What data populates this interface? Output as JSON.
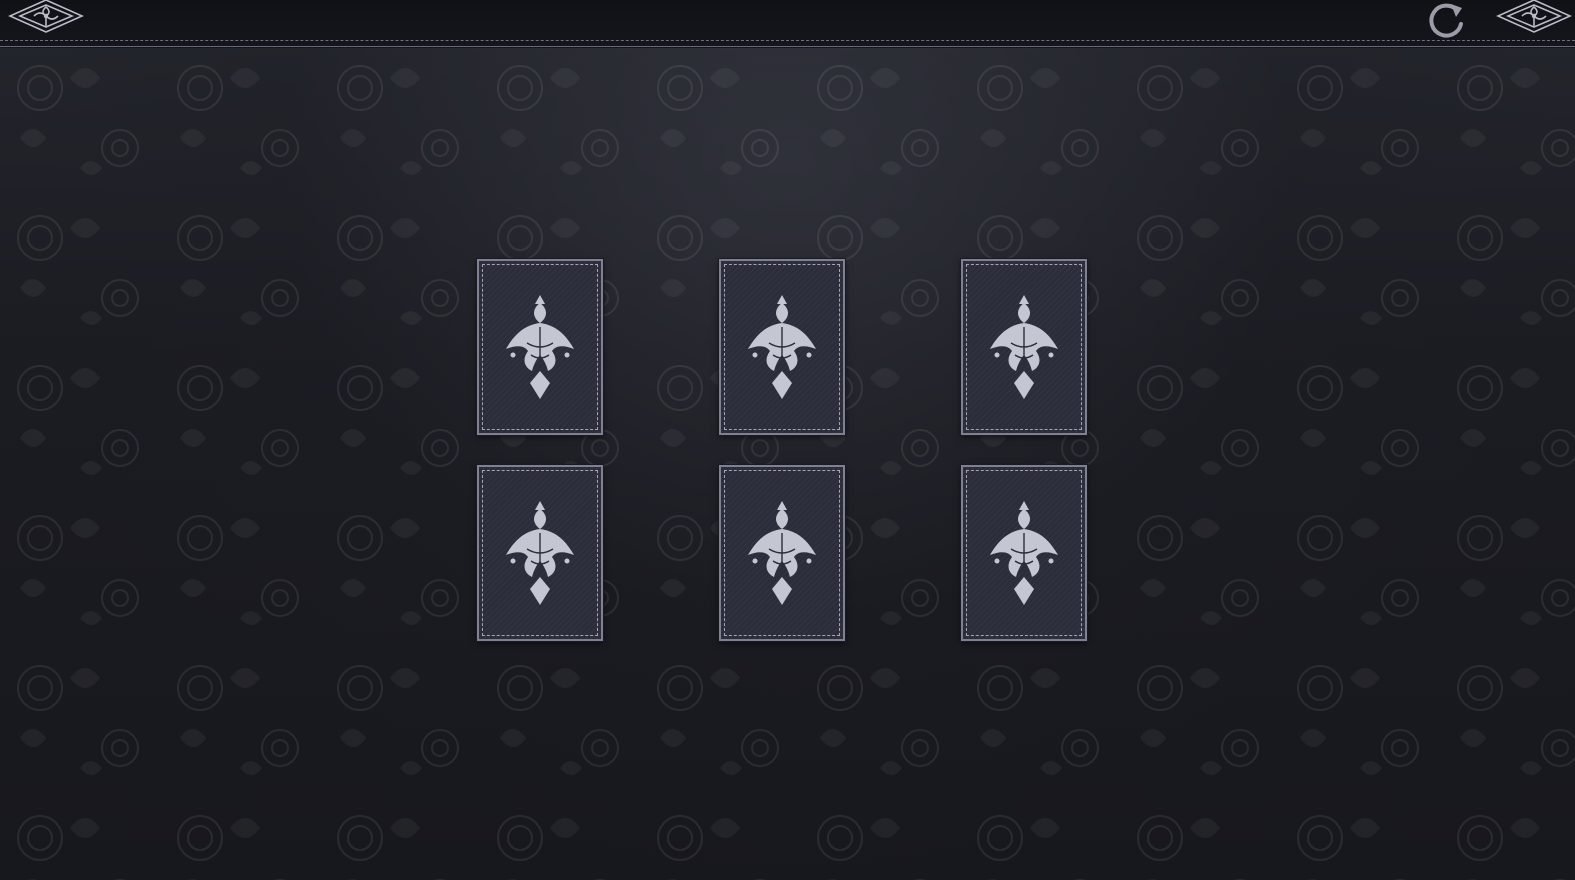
{
  "game": {
    "type": "memory-match",
    "face_down_cards": 6,
    "grid": {
      "rows": 2,
      "columns": 3
    }
  },
  "toolbar": {
    "left_icon": "ornament-icon",
    "restart_icon": "restart-icon",
    "right_icon": "ornament-icon"
  },
  "cards": [
    {
      "id": "card-1",
      "state": "face-down"
    },
    {
      "id": "card-2",
      "state": "face-down"
    },
    {
      "id": "card-3",
      "state": "face-down"
    },
    {
      "id": "card-4",
      "state": "face-down"
    },
    {
      "id": "card-5",
      "state": "face-down"
    },
    {
      "id": "card-6",
      "state": "face-down"
    }
  ],
  "colors": {
    "background": "#1b1c22",
    "card_back": "#2c2d3b",
    "card_border": "#7f8192",
    "ornament": "#b9bbc7"
  }
}
